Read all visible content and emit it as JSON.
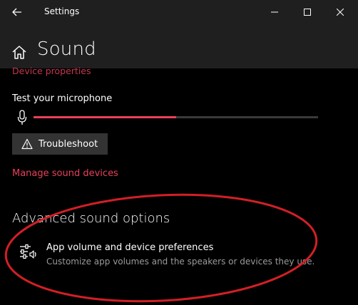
{
  "window": {
    "title": "Settings"
  },
  "header": {
    "title": "Sound"
  },
  "content": {
    "device_properties_link": "Device properties",
    "test_microphone_label": "Test your microphone",
    "mic_level_fraction": 0.5,
    "troubleshoot_label": "Troubleshoot",
    "manage_devices_link": "Manage sound devices",
    "advanced_section_title": "Advanced sound options",
    "app_volume_title": "App volume and device preferences",
    "app_volume_description": "Customize app volumes and the speakers or devices they use."
  },
  "colors": {
    "accent": "#e8405a",
    "annotation_ellipse": "#d31f26",
    "titlebar_bg": "#1f1f1f",
    "button_bg": "#333333"
  },
  "icons": {
    "back": "back-arrow-icon",
    "minimize": "minimize-icon",
    "maximize": "maximize-icon",
    "close": "close-icon",
    "home": "home-icon",
    "microphone": "microphone-icon",
    "warning": "warning-icon",
    "app_volume": "sliders-speaker-icon"
  }
}
